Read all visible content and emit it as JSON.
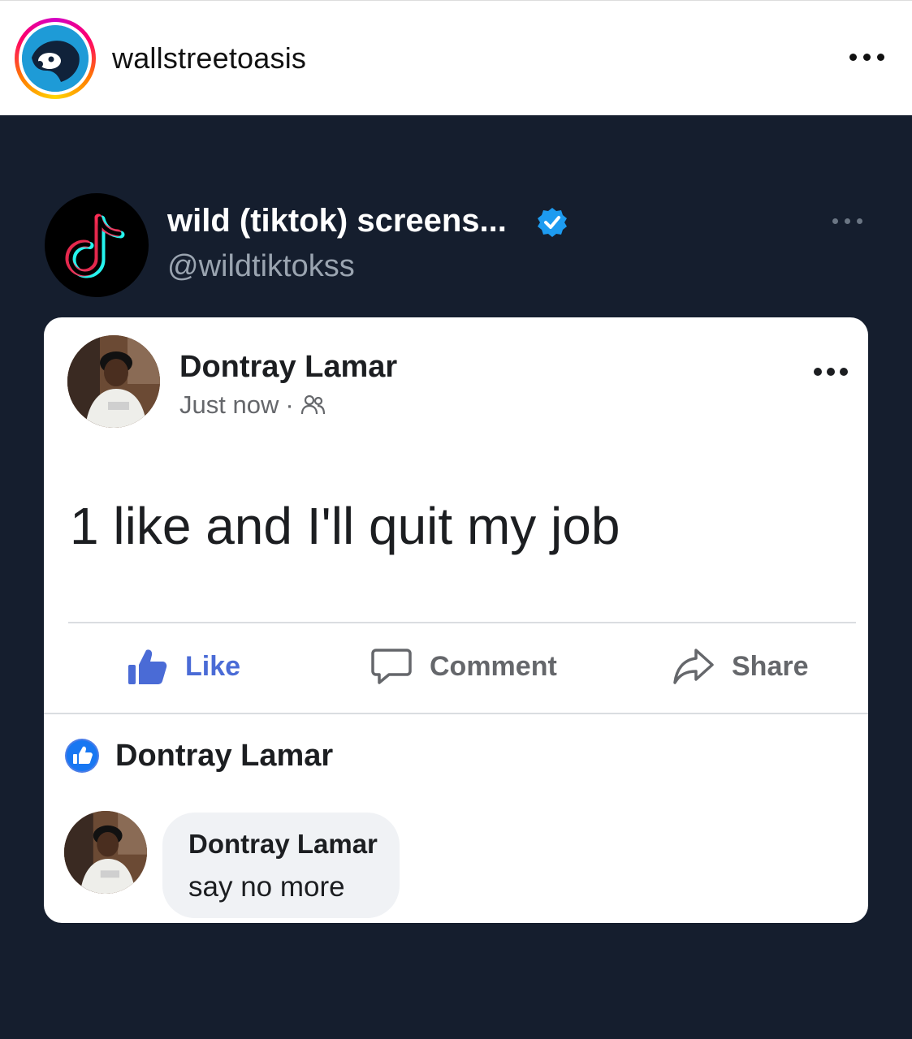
{
  "instagram_header": {
    "username": "wallstreetoasis",
    "more_icon": "more-horizontal-icon"
  },
  "tweet": {
    "display_name": "wild (tiktok) screens...",
    "handle": "@wildtiktokss",
    "verified": true,
    "avatar_icon": "tiktok-logo-icon"
  },
  "facebook_post": {
    "author": "Dontray Lamar",
    "timestamp": "Just now",
    "separator": "·",
    "audience_icon": "friends-icon",
    "text": "1 like and I'll quit my job",
    "actions": [
      {
        "label": "Like",
        "icon": "thumbs-up-icon"
      },
      {
        "label": "Comment",
        "icon": "comment-icon"
      },
      {
        "label": "Share",
        "icon": "share-icon"
      }
    ],
    "liked_by": "Dontray Lamar",
    "comment": {
      "author": "Dontray Lamar",
      "text": "say no more"
    }
  },
  "colors": {
    "tweet_background": "#151e2e",
    "like_blue": "#4a6bd6",
    "verified_blue": "#1d9bf0"
  }
}
